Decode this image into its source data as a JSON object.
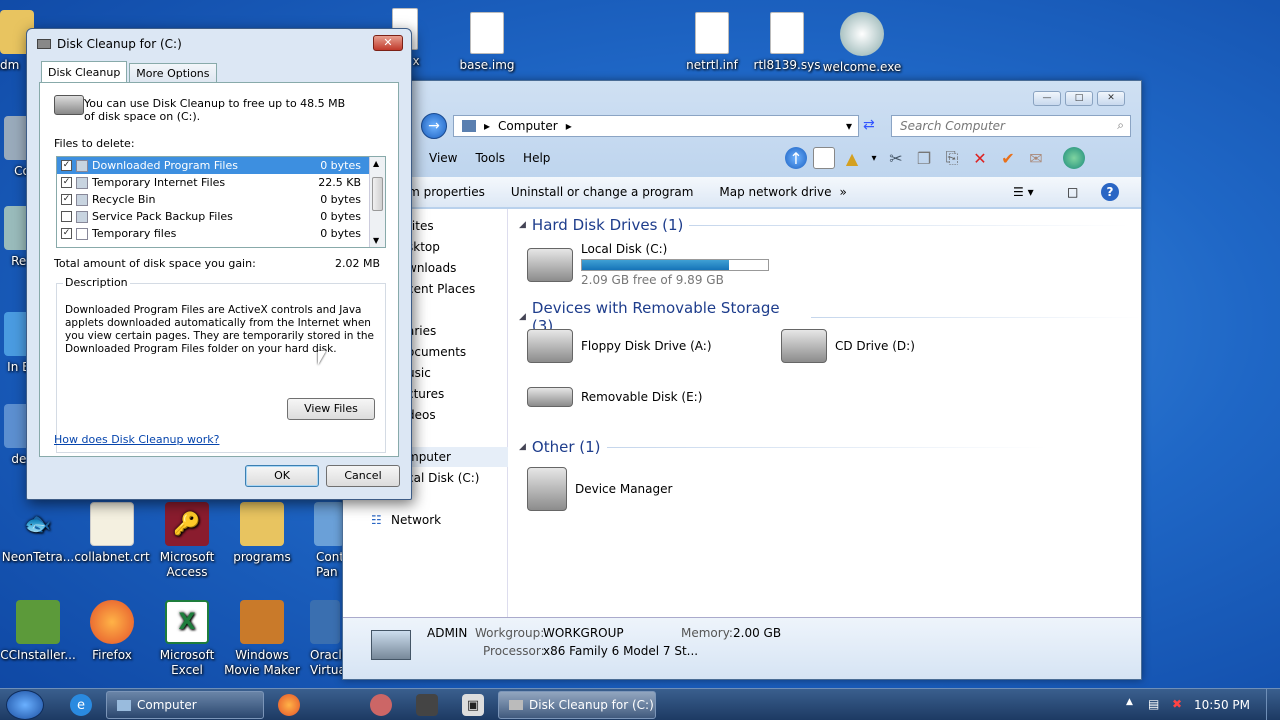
{
  "desktop": {
    "icons": [
      {
        "label": "Adm",
        "x": "left"
      },
      {
        "label": "base.img"
      },
      {
        "label": "netrtl.inf"
      },
      {
        "label": "rtl8139.sys"
      },
      {
        "label": "welcome.exe"
      },
      {
        "label": "NeonTetra..."
      },
      {
        "label": "collabnet.crt"
      },
      {
        "label": "Microsoft Access"
      },
      {
        "label": "programs"
      },
      {
        "label": "Contr Pan"
      },
      {
        "label": "CCInstaller..."
      },
      {
        "label": "Firefox"
      },
      {
        "label": "Microsoft Excel"
      },
      {
        "label": "Windows Movie Maker"
      },
      {
        "label": "Oracle Virtua"
      },
      {
        "label": "Co"
      },
      {
        "label": "Rec"
      },
      {
        "label": "In Ex"
      },
      {
        "label": "des"
      },
      {
        "label": "x"
      }
    ]
  },
  "explorer": {
    "address": "Computer",
    "search_placeholder": "Search Computer",
    "menu": [
      "View",
      "Tools",
      "Help"
    ],
    "commands": [
      "System properties",
      "Uninstall or change a program",
      "Map network drive",
      "»"
    ],
    "nav": [
      "rites",
      "sktop",
      "wnloads",
      "cent Places",
      "aries",
      "ocuments",
      "usic",
      "ctures",
      "deos",
      "mputer",
      "cal Disk (C:)",
      "Network"
    ],
    "groups": {
      "hdd": "Hard Disk Drives (1)",
      "removable": "Devices with Removable Storage (3)",
      "other": "Other (1)"
    },
    "local_disk": {
      "name": "Local Disk (C:)",
      "free": "2.09 GB free of 9.89 GB",
      "used_fraction": 0.79
    },
    "floppy": "Floppy Disk Drive (A:)",
    "cd": "CD Drive (D:)",
    "removable_disk": "Removable Disk (E:)",
    "device_manager": "Device Manager",
    "details": {
      "name": "ADMIN",
      "workgroup_label": "Workgroup:",
      "workgroup": "WORKGROUP",
      "memory_label": "Memory:",
      "memory": "2.00 GB",
      "processor_label": "Processor:",
      "processor": "x86 Family 6 Model 7 St..."
    }
  },
  "dialog": {
    "title": "Disk Cleanup for  (C:)",
    "close": "✕",
    "tabs": [
      "Disk Cleanup",
      "More Options"
    ],
    "intro": "You can use Disk Cleanup to free up to 48.5 MB of disk space on  (C:).",
    "files_label": "Files to delete:",
    "files": [
      {
        "name": "Downloaded Program Files",
        "size": "0 bytes",
        "checked": "✓"
      },
      {
        "name": "Temporary Internet Files",
        "size": "22.5 KB",
        "checked": "✓"
      },
      {
        "name": "Recycle Bin",
        "size": "0 bytes",
        "checked": "✓"
      },
      {
        "name": "Service Pack Backup Files",
        "size": "0 bytes",
        "checked": ""
      },
      {
        "name": "Temporary files",
        "size": "0 bytes",
        "checked": "✓"
      }
    ],
    "total_label": "Total amount of disk space you gain:",
    "total_value": "2.02 MB",
    "description_label": "Description",
    "description": "Downloaded Program Files are ActiveX controls and Java applets downloaded automatically from the Internet when you view certain pages. They are temporarily stored in the Downloaded Program Files folder on your hard disk.",
    "view_files": "View Files",
    "help_link": "How does Disk Cleanup work?",
    "ok": "OK",
    "cancel": "Cancel"
  },
  "taskbar": {
    "computer": "Computer",
    "disk_cleanup": "Disk Cleanup for  (C:)",
    "clock": "10:50 PM"
  },
  "colors": {
    "accent": "#3d8fe0",
    "link": "#0645ad",
    "group": "#1e3d8c"
  }
}
